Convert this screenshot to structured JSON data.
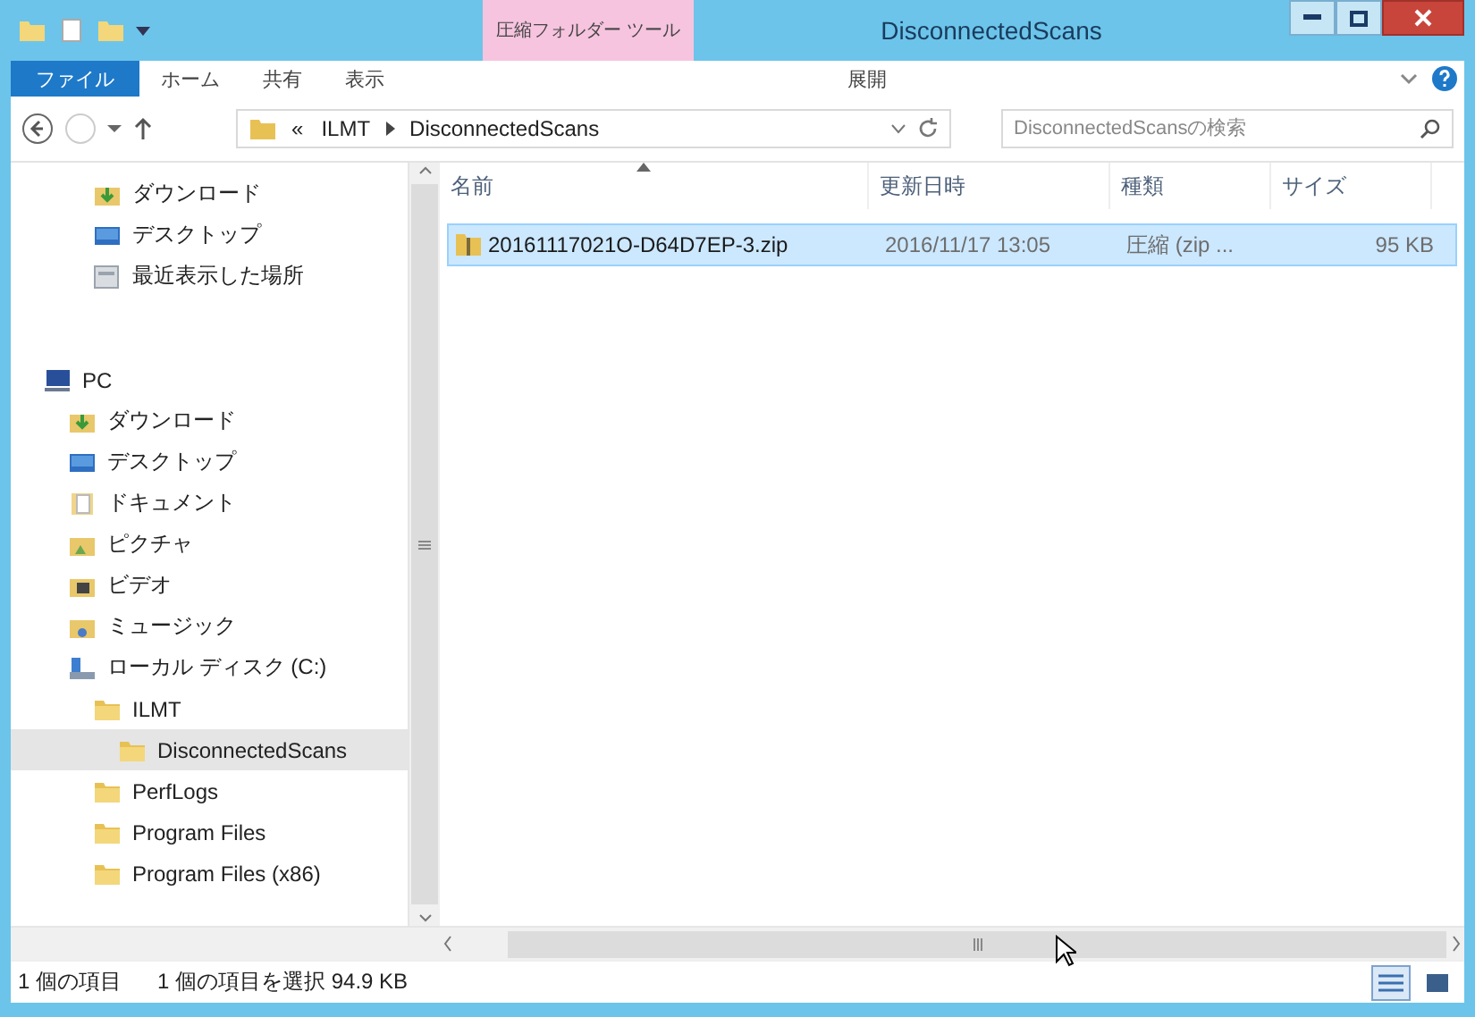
{
  "window": {
    "title": "DisconnectedScans",
    "context_tab_header": "圧縮フォルダー ツール"
  },
  "ribbon_tabs": [
    {
      "label": "ファイル",
      "kind": "file"
    },
    {
      "label": "ホーム",
      "kind": "tab"
    },
    {
      "label": "共有",
      "kind": "tab"
    },
    {
      "label": "表示",
      "kind": "tab"
    },
    {
      "label": "展開",
      "kind": "context"
    }
  ],
  "address_bar": {
    "overflow": "«",
    "path": [
      "ILMT",
      "DisconnectedScans"
    ]
  },
  "search": {
    "placeholder": "DisconnectedScansの検索"
  },
  "quick_access": [
    {
      "label": "ダウンロード",
      "kind": "download"
    },
    {
      "label": "デスクトップ",
      "kind": "desktop"
    },
    {
      "label": "最近表示した場所",
      "kind": "recent"
    }
  ],
  "tree": [
    {
      "label": "PC",
      "kind": "pc",
      "selected": false,
      "children": [
        {
          "label": "ダウンロード",
          "kind": "download",
          "selected": false
        },
        {
          "label": "デスクトップ",
          "kind": "desktop",
          "selected": false
        },
        {
          "label": "ドキュメント",
          "kind": "documents",
          "selected": false
        },
        {
          "label": "ピクチャ",
          "kind": "pictures",
          "selected": false
        },
        {
          "label": "ビデオ",
          "kind": "videos",
          "selected": false
        },
        {
          "label": "ミュージック",
          "kind": "music",
          "selected": false
        },
        {
          "label": "ローカル ディスク (C:)",
          "kind": "drive",
          "selected": false,
          "children": [
            {
              "label": "ILMT",
              "kind": "folder",
              "selected": false,
              "children": [
                {
                  "label": "DisconnectedScans",
                  "kind": "folder",
                  "selected": true
                }
              ]
            },
            {
              "label": "PerfLogs",
              "kind": "folder",
              "selected": false
            },
            {
              "label": "Program Files",
              "kind": "folder",
              "selected": false
            },
            {
              "label": "Program Files (x86)",
              "kind": "folder",
              "selected": false
            }
          ]
        }
      ]
    }
  ],
  "table": {
    "columns": [
      "名前",
      "更新日時",
      "種類",
      "サイズ"
    ],
    "rows": [
      {
        "cells": [
          "20161117021O-D64D7EP-3.zip",
          "2016/11/17 13:05",
          "圧縮 (zip ...",
          "95 KB"
        ],
        "selected": true
      }
    ]
  },
  "status_bar": {
    "item_count": "1 個の項目",
    "selection": "1 個の項目を選択 94.9 KB"
  },
  "view_buttons": [
    {
      "kind": "details",
      "selected": true
    },
    {
      "kind": "large-icons",
      "selected": false
    }
  ]
}
